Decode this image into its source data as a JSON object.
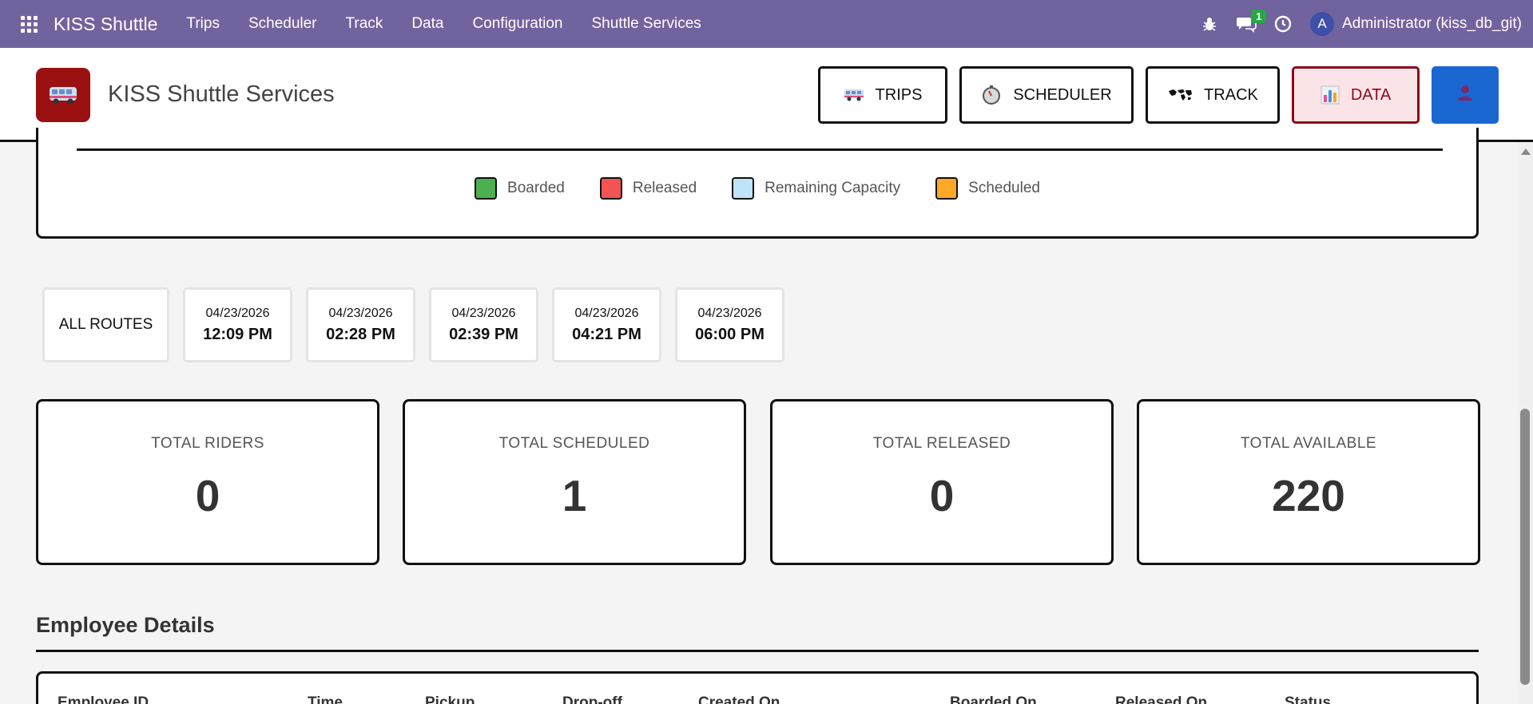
{
  "topnav": {
    "brand": "KISS Shuttle",
    "menu": [
      "Trips",
      "Scheduler",
      "Track",
      "Data",
      "Configuration",
      "Shuttle Services"
    ],
    "message_count": "1",
    "avatar_letter": "A",
    "user": "Administrator (kiss_db_git)",
    "color": "#71639e"
  },
  "header": {
    "title": "KISS Shuttle Services",
    "buttons": {
      "trips": "TRIPS",
      "scheduler": "SCHEDULER",
      "track": "TRACK",
      "data": "DATA"
    }
  },
  "legend": [
    {
      "label": "Boarded",
      "color": "#4caf50"
    },
    {
      "label": "Released",
      "color": "#f25454"
    },
    {
      "label": "Remaining Capacity",
      "color": "#bfe3f7"
    },
    {
      "label": "Scheduled",
      "color": "#ffa726"
    }
  ],
  "routes": {
    "all_label": "ALL ROUTES",
    "items": [
      {
        "date": "04/23/2026",
        "time": "12:09 PM"
      },
      {
        "date": "04/23/2026",
        "time": "02:28 PM"
      },
      {
        "date": "04/23/2026",
        "time": "02:39 PM"
      },
      {
        "date": "04/23/2026",
        "time": "04:21 PM"
      },
      {
        "date": "04/23/2026",
        "time": "06:00 PM"
      }
    ]
  },
  "stats": [
    {
      "label": "TOTAL RIDERS",
      "value": "0"
    },
    {
      "label": "TOTAL SCHEDULED",
      "value": "1"
    },
    {
      "label": "TOTAL RELEASED",
      "value": "0"
    },
    {
      "label": "TOTAL AVAILABLE",
      "value": "220"
    }
  ],
  "employee_details": {
    "title": "Employee Details",
    "columns": [
      "Employee ID",
      "Time",
      "Pickup",
      "Drop-off",
      "Created On",
      "Boarded On",
      "Released On",
      "Status"
    ]
  }
}
